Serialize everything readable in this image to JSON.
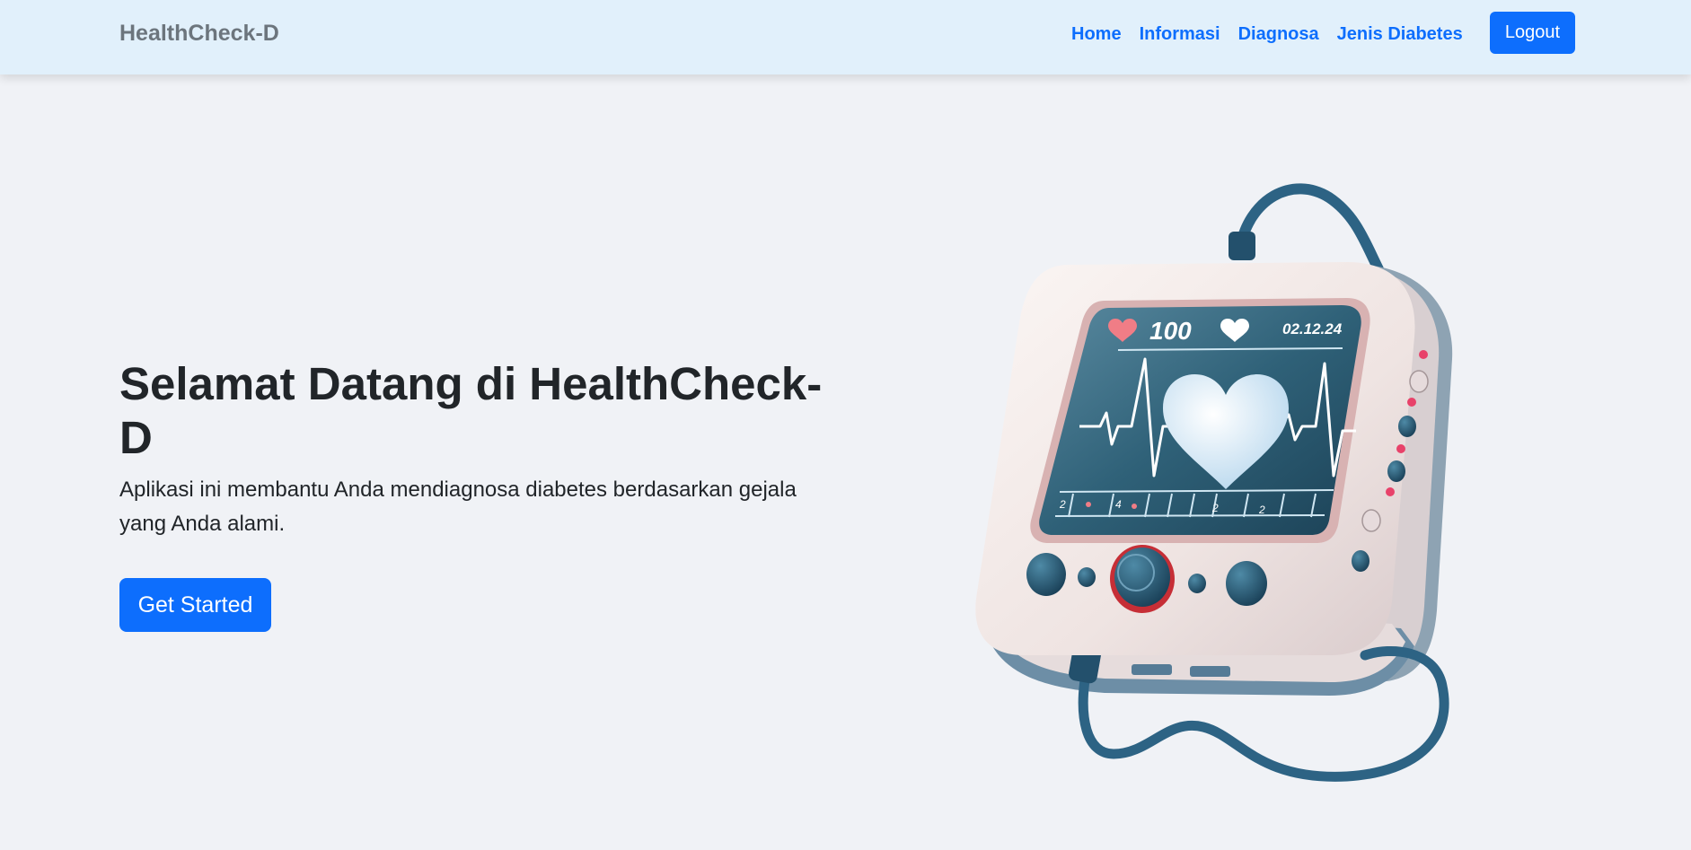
{
  "navbar": {
    "brand": "HealthCheck-D",
    "links": [
      "Home",
      "Informasi",
      "Diagnosa",
      "Jenis Diabetes"
    ],
    "logout_label": "Logout"
  },
  "hero": {
    "title": "Selamat Datang di HealthCheck-D",
    "description": "Aplikasi ini membantu Anda mendiagnosa diabetes berdasarkan gejala yang Anda alami.",
    "cta_label": "Get Started"
  },
  "device": {
    "reading": "100",
    "date": "02.12.24",
    "tick_labels": [
      "2",
      "4",
      "2",
      "2"
    ]
  },
  "colors": {
    "primary": "#0d6efd",
    "navbar_bg": "#e1f0fb",
    "page_bg": "#f0f2f6",
    "brand_text": "#6c757d",
    "heading_text": "#212529"
  }
}
